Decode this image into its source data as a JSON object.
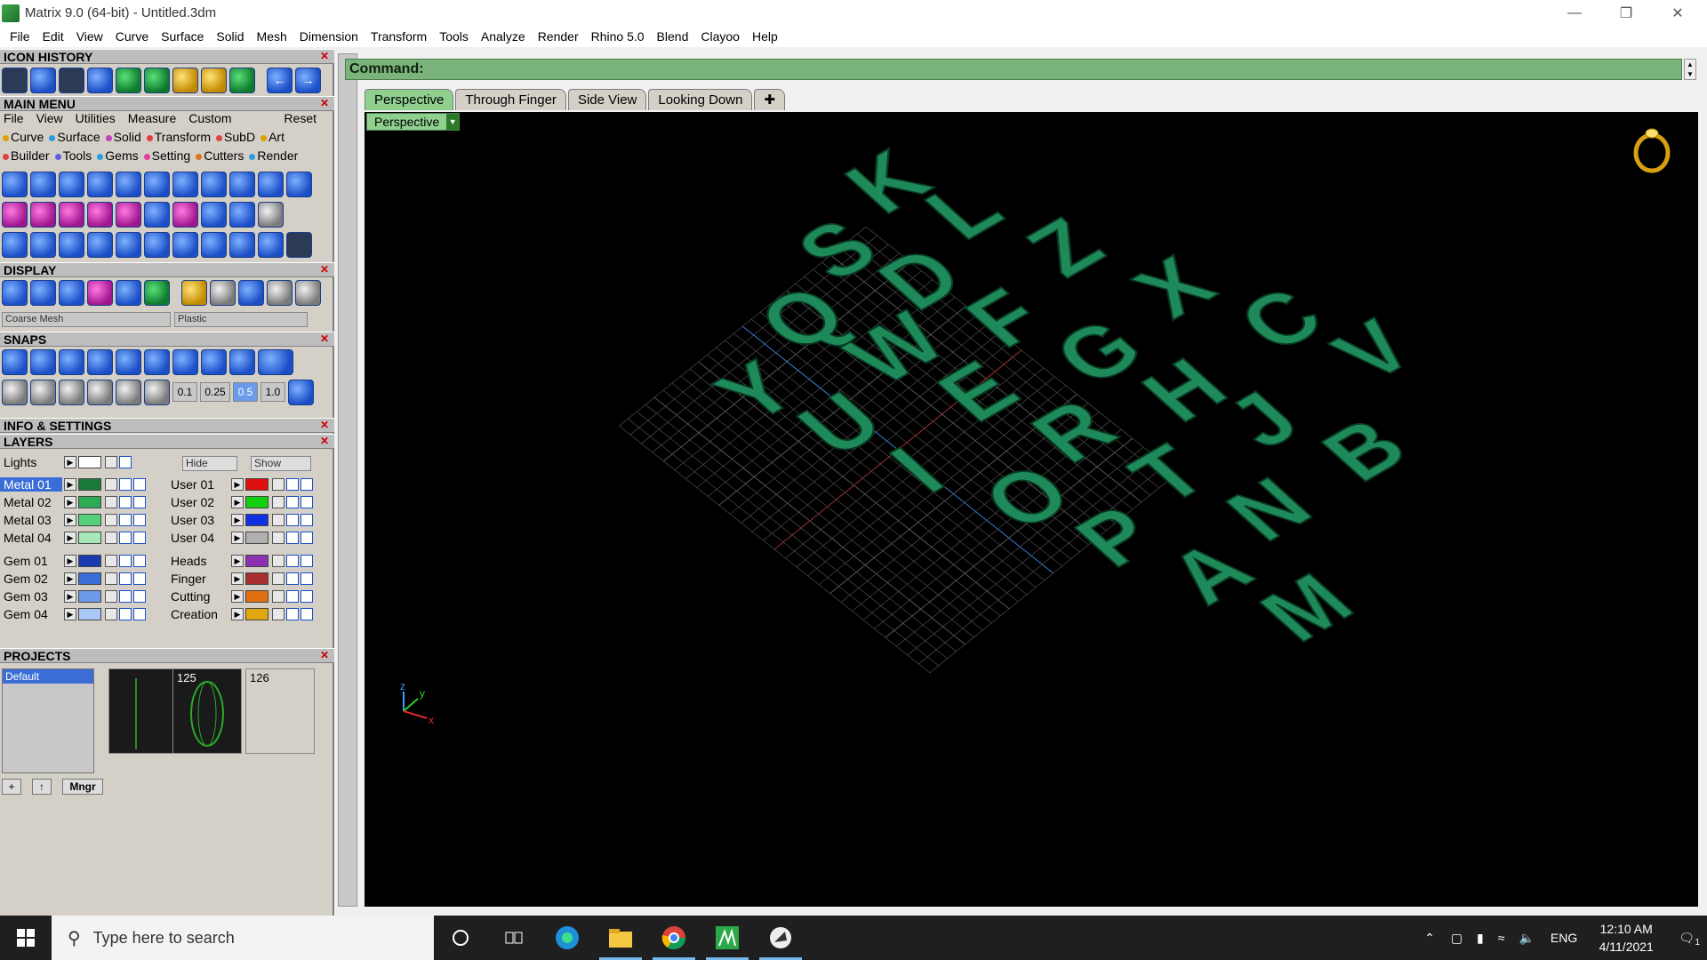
{
  "window": {
    "title": "Matrix 9.0 (64-bit) - Untitled.3dm"
  },
  "menu": [
    "File",
    "Edit",
    "View",
    "Curve",
    "Surface",
    "Solid",
    "Mesh",
    "Dimension",
    "Transform",
    "Tools",
    "Analyze",
    "Render",
    "Rhino 5.0",
    "Blend",
    "Clayoo",
    "Help"
  ],
  "panels": {
    "icon_history": "ICON HISTORY",
    "main_menu": "MAIN MENU",
    "display": "DISPLAY",
    "snaps": "SNAPS",
    "info": "INFO & SETTINGS",
    "layers": "LAYERS",
    "projects": "PROJECTS"
  },
  "main_menu": {
    "submenu": [
      "File",
      "View",
      "Utilities",
      "Measure",
      "Custom"
    ],
    "reset": "Reset",
    "row1": [
      "Curve",
      "Surface",
      "Solid",
      "Transform",
      "SubD",
      "Art"
    ],
    "row2": [
      "Builder",
      "Tools",
      "Gems",
      "Setting",
      "Cutters",
      "Render"
    ],
    "row1_colors": [
      "#e0a000",
      "#2a9de0",
      "#c040c0",
      "#e04040",
      "#e04040",
      "#e0a000"
    ],
    "row2_colors": [
      "#e04040",
      "#6060e0",
      "#2a9de0",
      "#e040a0",
      "#e07020",
      "#2a9de0"
    ]
  },
  "display": {
    "mesh": "Coarse Mesh",
    "material": "Plastic"
  },
  "snaps": {
    "values": [
      "0.1",
      "0.25",
      "0.5",
      "1.0"
    ]
  },
  "layers": {
    "lights": "Lights",
    "hide": "Hide",
    "show": "Show",
    "left": [
      {
        "name": "Metal 01",
        "color": "#1a7a3a",
        "active": true
      },
      {
        "name": "Metal 02",
        "color": "#2eaa55"
      },
      {
        "name": "Metal 03",
        "color": "#55d07a"
      },
      {
        "name": "Metal 04",
        "color": "#a8e8b8"
      },
      {
        "name": "Gem 01",
        "color": "#1a3ab0"
      },
      {
        "name": "Gem 02",
        "color": "#3a6ed6"
      },
      {
        "name": "Gem 03",
        "color": "#6a9ae8"
      },
      {
        "name": "Gem 04",
        "color": "#a8c8f8"
      }
    ],
    "right": [
      {
        "name": "User 01",
        "color": "#e01010"
      },
      {
        "name": "User 02",
        "color": "#10d010"
      },
      {
        "name": "User 03",
        "color": "#1030e0"
      },
      {
        "name": "User 04",
        "color": "#b0b0b0"
      },
      {
        "name": "Heads",
        "color": "#8a30b0"
      },
      {
        "name": "Finger",
        "color": "#a83030"
      },
      {
        "name": "Cutting",
        "color": "#e07010"
      },
      {
        "name": "Creation",
        "color": "#e0a810"
      }
    ]
  },
  "projects": {
    "default": "Default",
    "thumbs": [
      "125",
      "126"
    ],
    "mngr": "Mngr"
  },
  "command": {
    "label": "Command:",
    "value": ""
  },
  "tabs": [
    "Perspective",
    "Through Finger",
    "Side View",
    "Looking Down"
  ],
  "viewport": {
    "label": "Perspective",
    "axis_z": "z",
    "axis_y": "y",
    "axis_x": "x"
  },
  "letters": [
    "K",
    "L",
    "Z",
    "X",
    "C",
    "V",
    "S",
    "D",
    "F",
    "G",
    "H",
    "J",
    "B",
    "Q",
    "W",
    "E",
    "R",
    "T",
    "N",
    "Y",
    "U",
    "I",
    "O",
    "P",
    "A",
    "M"
  ],
  "taskbar": {
    "search_placeholder": "Type here to search",
    "lang": "ENG",
    "time": "12:10 AM",
    "date": "4/11/2021",
    "notif": "1"
  }
}
